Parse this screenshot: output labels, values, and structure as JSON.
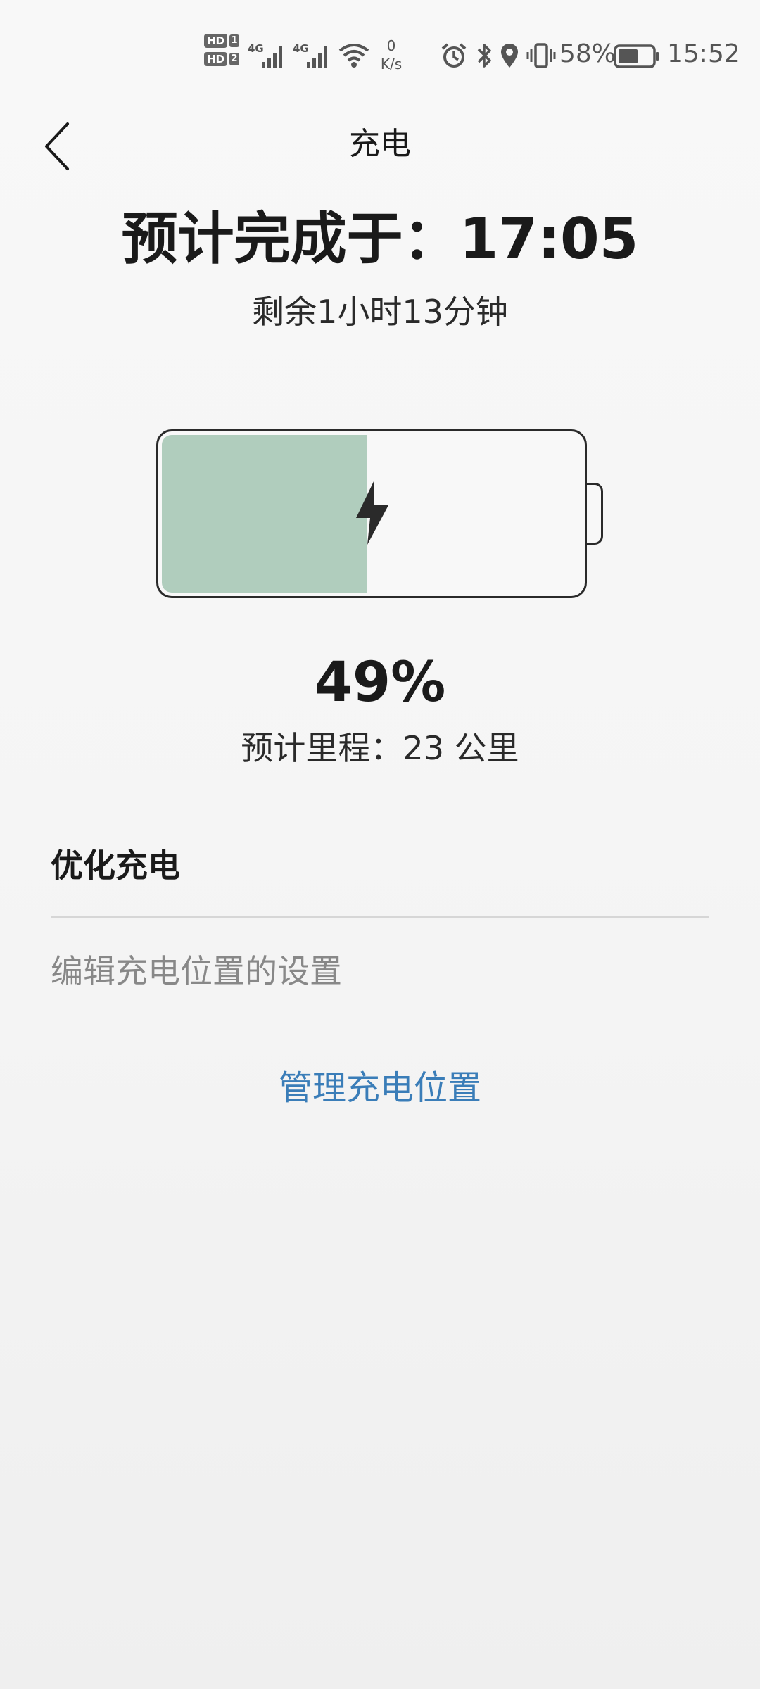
{
  "status_bar": {
    "sim1_badge": "HD",
    "sim1_num": "1",
    "sim2_badge": "HD",
    "sim2_num": "2",
    "network_type_1": "4G",
    "network_type_2": "4G",
    "net_speed_value": "0",
    "net_speed_unit": "K/s",
    "battery_percent": "58%",
    "battery_level": 0.58,
    "time": "15:52",
    "icons": [
      "signal-icon",
      "wifi-icon",
      "alarm-icon",
      "bluetooth-icon",
      "location-icon",
      "vibrate-icon",
      "battery-icon"
    ]
  },
  "header": {
    "title": "充电",
    "back_icon": "chevron-left-icon"
  },
  "charging": {
    "eta_title": "预计完成于：17:05",
    "remaining": "剩余1小时13分钟",
    "level_percent": 49,
    "percent_label": "49%",
    "range_label": "预计里程：23 公里",
    "fill_color": "#b0cdbd",
    "bolt_icon": "lightning-bolt-icon"
  },
  "optimize": {
    "heading": "优化充电",
    "settings_text": "编辑充电位置的设置",
    "manage_link": "管理充电位置",
    "link_color": "#3a7db8"
  }
}
